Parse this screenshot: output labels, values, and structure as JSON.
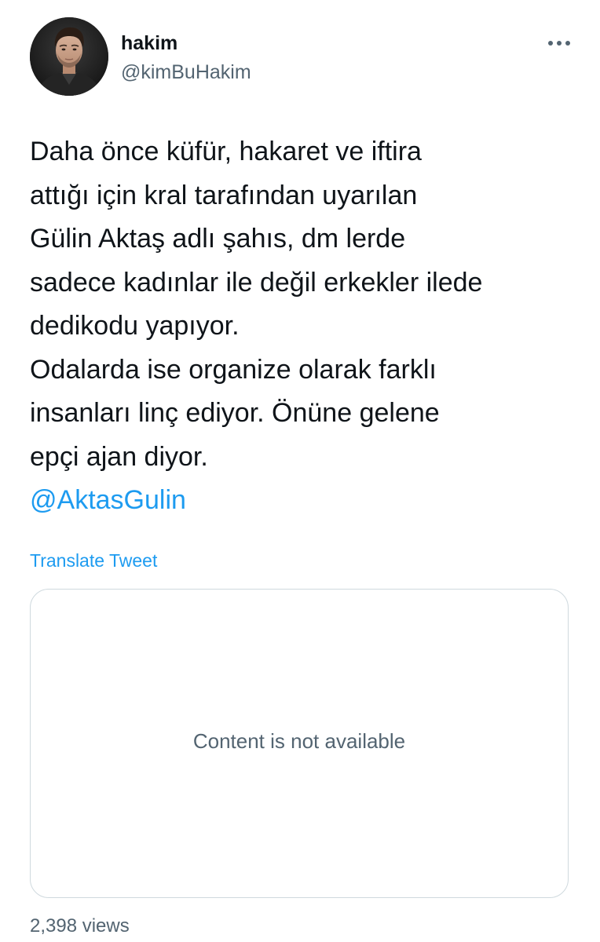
{
  "author": {
    "name": "hakim",
    "handle": "@kimBuHakim",
    "avatar_icon": "profile-photo"
  },
  "header": {
    "more_icon": "more-horizontal-icon"
  },
  "tweet": {
    "lines": [
      "Daha önce küfür, hakaret ve iftira",
      "attığı için kral tarafından uyarılan",
      "Gülin Aktaş adlı şahıs, dm lerde",
      "sadece kadınlar ile değil erkekler ilede",
      "dedikodu yapıyor.",
      "Odalarda ise organize olarak farklı",
      "insanları linç ediyor. Önüne gelene",
      "epçi ajan diyor."
    ],
    "mention": "@AktasGulin"
  },
  "translate_label": "Translate Tweet",
  "media_card": {
    "message": "Content is not available"
  },
  "stats": {
    "views": "2,398 views"
  },
  "colors": {
    "text_primary": "#0f1419",
    "text_secondary": "#536471",
    "link": "#1d9bf0",
    "card_border": "#cfd9de"
  }
}
